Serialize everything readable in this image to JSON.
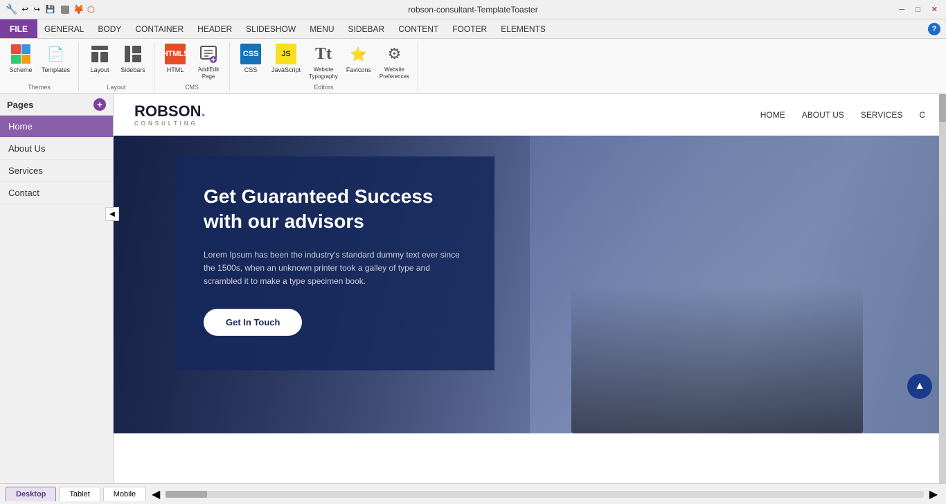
{
  "titlebar": {
    "title": "robson-consultant-TemplateToaster",
    "minimize": "─",
    "maximize": "□",
    "close": "✕"
  },
  "menubar": {
    "file": "FILE",
    "items": [
      "GENERAL",
      "BODY",
      "CONTAINER",
      "HEADER",
      "SLIDESHOW",
      "MENU",
      "SIDEBAR",
      "CONTENT",
      "FOOTER",
      "ELEMENTS"
    ]
  },
  "ribbon": {
    "themes_group": "Themes",
    "scheme_label": "Scheme",
    "templates_label": "Templates",
    "layout_group": "Layout",
    "layout_label": "Layout",
    "sidebars_label": "Sidebars",
    "cms_group": "CMS",
    "html_label": "HTML",
    "addedit_label": "Add/Edit\nPage",
    "editors_group": "Editors",
    "css_label": "CSS",
    "js_label": "JavaScript",
    "typography_label": "Website\nTypography",
    "favicons_label": "Favicons",
    "preferences_label": "Website\nPreferences"
  },
  "pages": {
    "header": "Pages",
    "add_btn": "+",
    "items": [
      "Home",
      "About Us",
      "Services",
      "Contact"
    ]
  },
  "preview": {
    "logo_main": "ROBSON.",
    "logo_sub": "CONSULTING",
    "nav_links": [
      "HOME",
      "ABOUT US",
      "SERVICES",
      "C"
    ],
    "hero_title": "Get Guaranteed Success\nwith our advisors",
    "hero_text": "Lorem Ipsum has been the industry's standard dummy text ever since the 1500s, when an unknown printer took a galley of type and scrambled it to make a type specimen book.",
    "cta_button": "Get In Touch"
  },
  "bottom": {
    "tabs": [
      "Desktop",
      "Tablet",
      "Mobile"
    ]
  }
}
